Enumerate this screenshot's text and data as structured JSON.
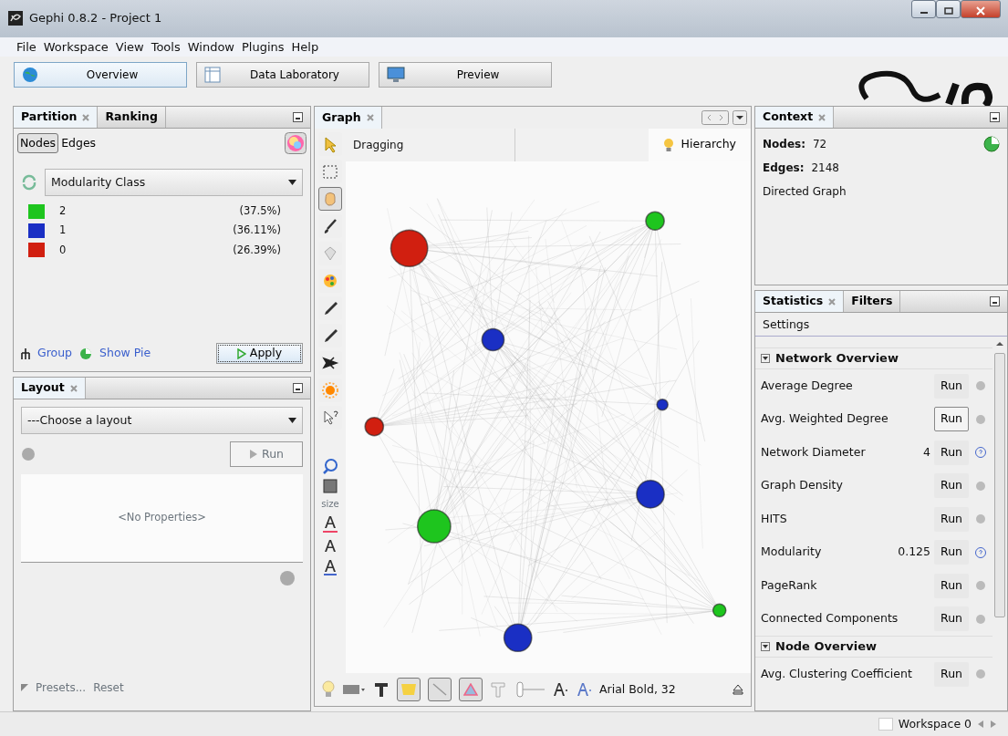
{
  "window": {
    "title": "Gephi 0.8.2 - Project 1"
  },
  "menu": [
    "File",
    "Workspace",
    "View",
    "Tools",
    "Window",
    "Plugins",
    "Help"
  ],
  "perspectives": [
    {
      "label": "Overview",
      "selected": true
    },
    {
      "label": "Data Laboratory",
      "selected": false
    },
    {
      "label": "Preview",
      "selected": false
    }
  ],
  "partition_panel": {
    "tabs": [
      {
        "label": "Partition",
        "selected": true
      },
      {
        "label": "Ranking",
        "selected": false
      }
    ],
    "subtabs": [
      {
        "label": "Nodes",
        "selected": true
      },
      {
        "label": "Edges",
        "selected": false
      }
    ],
    "dropdown": "Modularity Class",
    "classes": [
      {
        "label": "2",
        "percent": "(37.5%)",
        "color": "#1ec51e"
      },
      {
        "label": "1",
        "percent": "(36.11%)",
        "color": "#1a2fc4"
      },
      {
        "label": "0",
        "percent": "(26.39%)",
        "color": "#d11f10"
      }
    ],
    "group_link": "Group",
    "pie_link": "Show Pie",
    "apply": "Apply"
  },
  "layout_panel": {
    "title": "Layout",
    "dropdown": "---Choose a layout",
    "run": "Run",
    "properties": "<No Properties>",
    "presets": "Presets...",
    "reset": "Reset"
  },
  "graph_panel": {
    "tab": "Graph",
    "mode": "Dragging",
    "hierarchy": "Hierarchy",
    "size_label": "size",
    "font": "Arial Bold, 32",
    "tools": [
      {
        "selected": false
      },
      {
        "selected": false
      },
      {
        "selected": true
      },
      {
        "selected": false
      },
      {
        "selected": false
      },
      {
        "selected": false
      },
      {
        "selected": false
      },
      {
        "selected": false
      },
      {
        "selected": false
      },
      {
        "selected": false
      },
      {
        "selected": false
      }
    ],
    "nodes": [
      {
        "color": "#d11f10"
      },
      {
        "color": "#1ec51e"
      },
      {
        "color": "#1a2fc4"
      },
      {
        "color": "#1a2fc4"
      },
      {
        "color": "#d11f10"
      },
      {
        "color": "#1a2fc4"
      },
      {
        "color": "#1ec51e"
      },
      {
        "color": "#1ec51e"
      },
      {
        "color": "#1a2fc4"
      }
    ]
  },
  "context": {
    "title": "Context",
    "nodes_label": "Nodes:",
    "nodes": "72",
    "edges_label": "Edges:",
    "edges": "2148",
    "graph_type": "Directed Graph"
  },
  "statistics": {
    "tabs": [
      {
        "label": "Statistics",
        "selected": true
      },
      {
        "label": "Filters",
        "selected": false
      }
    ],
    "settings": "Settings",
    "sections": [
      {
        "title": "Network Overview",
        "expanded": true,
        "items": [
          {
            "name": "Average Degree",
            "run": "Run",
            "hovered": false
          },
          {
            "name": "Avg. Weighted Degree",
            "run": "Run",
            "hovered": true
          },
          {
            "name": "Network Diameter",
            "value": "4",
            "run": "Run",
            "hovered": false
          },
          {
            "name": "Graph Density",
            "run": "Run",
            "hovered": false
          },
          {
            "name": "HITS",
            "run": "Run",
            "hovered": false
          },
          {
            "name": "Modularity",
            "value": "0.125",
            "run": "Run",
            "hovered": false
          },
          {
            "name": "PageRank",
            "run": "Run",
            "hovered": false
          },
          {
            "name": "Connected Components",
            "run": "Run",
            "hovered": false
          }
        ]
      },
      {
        "title": "Node Overview",
        "expanded": true,
        "items": [
          {
            "name": "Avg. Clustering Coefficient",
            "run": "Run",
            "hovered": false
          }
        ]
      }
    ]
  },
  "status_bar": {
    "workspace": "Workspace 0"
  }
}
